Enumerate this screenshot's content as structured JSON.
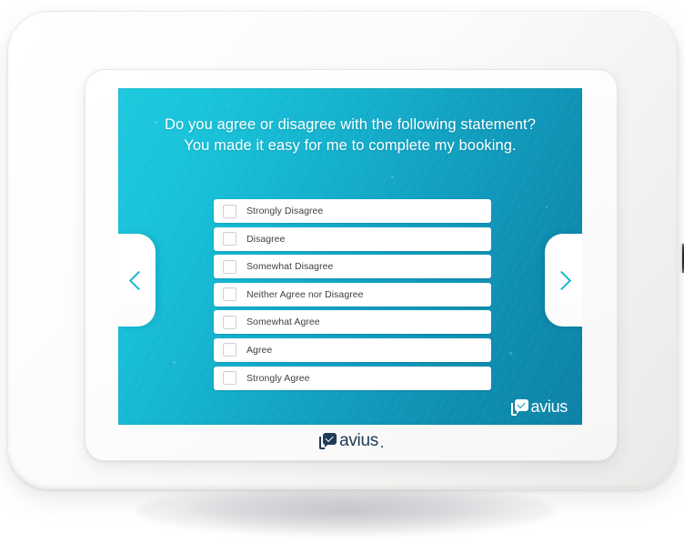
{
  "device": {
    "name": "avius-survey-tablet-kiosk",
    "side_button": "power-button"
  },
  "screen": {
    "background_gradient_from": "#1ec9de",
    "background_gradient_to": "#0d82a6",
    "question": {
      "line1": "Do you agree or disagree with the following statement?",
      "line2": "You made it easy for me to complete my booking."
    },
    "options": [
      {
        "label": "Strongly Disagree",
        "checked": false
      },
      {
        "label": "Disagree",
        "checked": false
      },
      {
        "label": "Somewhat Disagree",
        "checked": false
      },
      {
        "label": "Neither Agree nor Disagree",
        "checked": false
      },
      {
        "label": "Somewhat Agree",
        "checked": false
      },
      {
        "label": "Agree",
        "checked": false
      },
      {
        "label": "Strongly Agree",
        "checked": false
      }
    ],
    "nav": {
      "prev_icon": "chevron-left-icon",
      "next_icon": "chevron-right-icon",
      "accent_color": "#17b8d4"
    },
    "logo": {
      "wordmark": "avius",
      "mark_icon": "speech-bubble-check-icon",
      "color": "#ffffff"
    }
  },
  "bezel": {
    "logo": {
      "wordmark": "avius",
      "mark_icon": "speech-bubble-check-icon",
      "color": "#213a56"
    }
  }
}
